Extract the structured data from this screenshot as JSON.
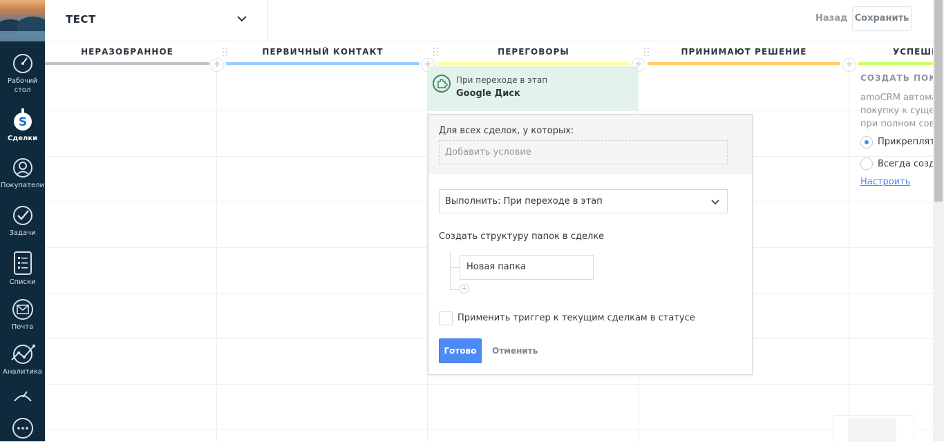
{
  "sidebar": {
    "items": [
      {
        "label": "Рабочий стол",
        "icon": "dashboard-icon"
      },
      {
        "label": "Сделки",
        "icon": "deals-icon"
      },
      {
        "label": "Покупатели",
        "icon": "customers-icon"
      },
      {
        "label": "Задачи",
        "icon": "tasks-icon"
      },
      {
        "label": "Списки",
        "icon": "lists-icon"
      },
      {
        "label": "Почта",
        "icon": "mail-icon"
      },
      {
        "label": "Аналитика",
        "icon": "analytics-icon"
      }
    ]
  },
  "header": {
    "pipeline_name": "ТЕСТ",
    "back_label": "Назад",
    "save_label": "Сохранить"
  },
  "columns": [
    {
      "title": "НЕРАЗОБРАННОЕ",
      "color": "#c2c2c2"
    },
    {
      "title": "ПЕРВИЧНЫЙ КОНТАКТ",
      "color": "#99ccff"
    },
    {
      "title": "ПЕРЕГОВОРЫ",
      "color": "#ffff99"
    },
    {
      "title": "ПРИНИМАЮТ РЕШЕНИЕ",
      "color": "#ffcc66"
    },
    {
      "title": "УСПЕШН",
      "color": "#ccff66"
    }
  ],
  "trigger": {
    "line1": "При переходе в этап",
    "line2": "Google Диск"
  },
  "popup": {
    "condition_label": "Для всех сделок, у которых:",
    "condition_placeholder": "Добавить условие",
    "execute_value": "Выполнить: При переходе в этап",
    "structure_label": "Создать структуру папок в сделке",
    "folder_value": "Новая папка",
    "apply_label": "Применить триггер к текущим сделкам в статусе",
    "done_label": "Готово",
    "cancel_label": "Отменить"
  },
  "right_panel": {
    "title": "СОЗДАТЬ ПОКУ",
    "desc_lines": [
      "amoCRM автома",
      "покупку к сущес",
      "при полном сов"
    ],
    "option1": "Прикреплят",
    "option2": "Всегда созда",
    "link": "Настроить"
  },
  "colors": {
    "sidebar_bg": "#0f2a3c",
    "accent": "#4c8bf5",
    "trigger_bg": "#e3f2ea"
  }
}
